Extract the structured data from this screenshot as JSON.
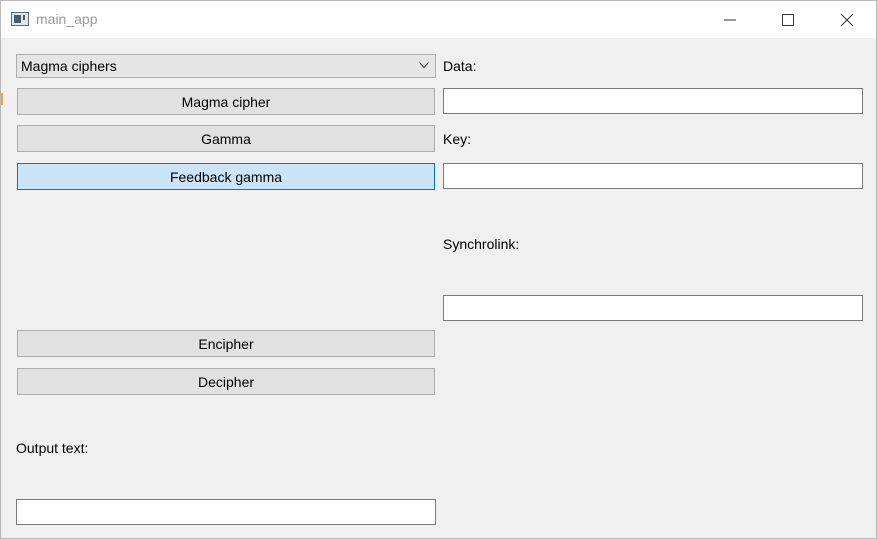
{
  "window": {
    "title": "main_app"
  },
  "cipher_select": {
    "selected": "Magma ciphers"
  },
  "mode_buttons": [
    {
      "label": "Magma cipher",
      "selected": false
    },
    {
      "label": "Gamma",
      "selected": false
    },
    {
      "label": "Feedback gamma",
      "selected": true
    }
  ],
  "actions": {
    "encipher_label": "Encipher",
    "decipher_label": "Decipher"
  },
  "labels": {
    "output_text": "Output text:",
    "data": "Data:",
    "key": "Key:",
    "synchrolink": "Synchrolink:"
  },
  "fields": {
    "output_value": "",
    "data_value": "",
    "key_value": "",
    "synchrolink_value": ""
  },
  "icons": {
    "minimize": "minimize-icon",
    "maximize": "maximize-icon",
    "close": "close-icon",
    "dropdown": "chevron-down-icon",
    "app": "app-window-icon"
  },
  "colors": {
    "selected_button_bg": "#cce4f7",
    "selected_button_border": "#0078d7",
    "title_text": "#9a9a9a"
  }
}
